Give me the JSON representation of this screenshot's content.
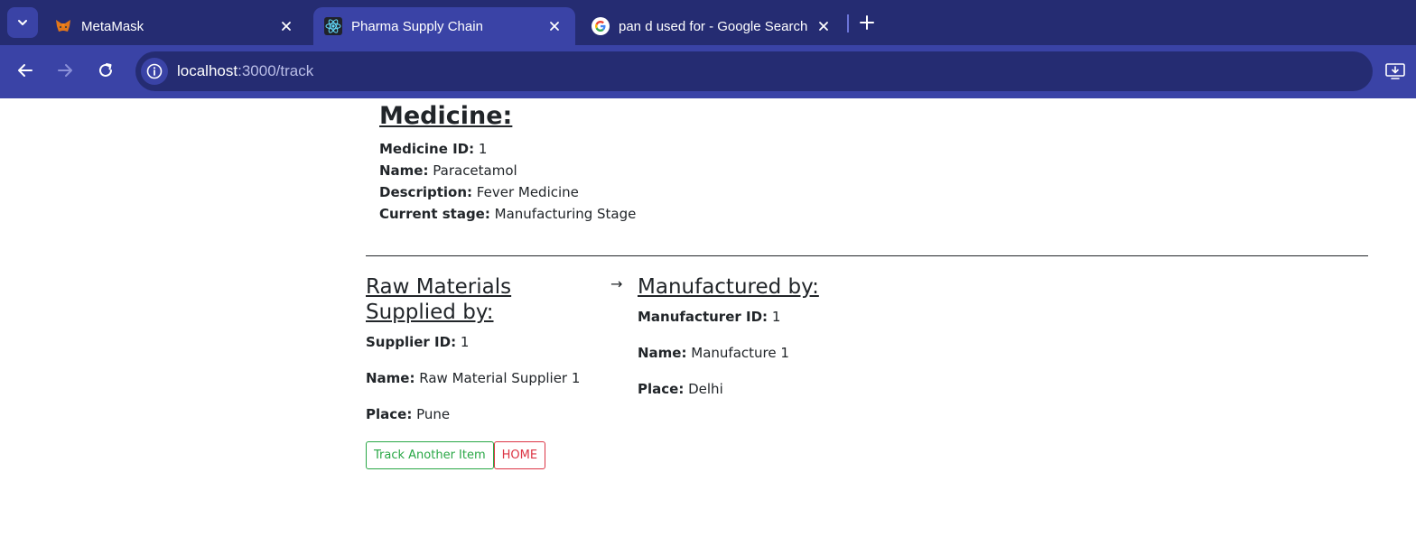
{
  "browser": {
    "tabs": [
      {
        "title": "MetaMask",
        "favicon": "metamask-fox-icon",
        "active": false
      },
      {
        "title": "Pharma Supply Chain",
        "favicon": "react-atom-icon",
        "active": true
      },
      {
        "title": "pan d used for - Google Search",
        "favicon": "google-g-icon",
        "active": false
      }
    ],
    "address": {
      "host": "localhost",
      "path": ":3000/track"
    },
    "colors": {
      "tabstrip": "#252c72",
      "toolbar": "#3a43a6"
    }
  },
  "medicine": {
    "heading": "Medicine:",
    "id_label": "Medicine ID:",
    "id_value": "1",
    "name_label": "Name:",
    "name_value": "Paracetamol",
    "description_label": "Description:",
    "description_value": "Fever Medicine",
    "stage_label": "Current stage:",
    "stage_value": "Manufacturing Stage"
  },
  "supplier": {
    "heading": "Raw Materials Supplied by:",
    "id_label": "Supplier ID:",
    "id_value": "1",
    "name_label": "Name:",
    "name_value": "Raw Material Supplier 1",
    "place_label": "Place:",
    "place_value": "Pune"
  },
  "arrow": "→",
  "manufacturer": {
    "heading": "Manufactured by:",
    "id_label": "Manufacturer ID:",
    "id_value": "1",
    "name_label": "Name:",
    "name_value": "Manufacture 1",
    "place_label": "Place:",
    "place_value": "Delhi"
  },
  "buttons": {
    "track_another": "Track Another Item",
    "home": "HOME"
  }
}
